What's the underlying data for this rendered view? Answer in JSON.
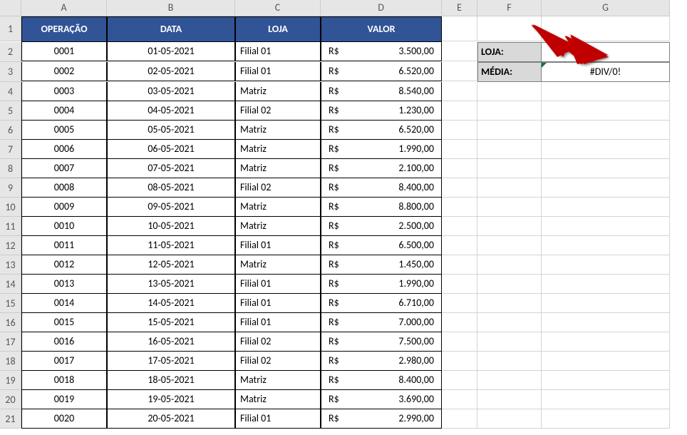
{
  "columns": [
    "A",
    "B",
    "C",
    "D",
    "E",
    "F",
    "G"
  ],
  "header": {
    "operacao": "OPERAÇÃO",
    "data": "DATA",
    "loja": "LOJA",
    "valor": "VALOR"
  },
  "rows": [
    {
      "op": "0001",
      "data": "01-05-2021",
      "loja": "Filial 01",
      "cur": "R$",
      "val": "3.500,00"
    },
    {
      "op": "0002",
      "data": "02-05-2021",
      "loja": "Filial 01",
      "cur": "R$",
      "val": "6.520,00"
    },
    {
      "op": "0003",
      "data": "03-05-2021",
      "loja": "Matriz",
      "cur": "R$",
      "val": "8.540,00"
    },
    {
      "op": "0004",
      "data": "04-05-2021",
      "loja": "Filial 02",
      "cur": "R$",
      "val": "1.230,00"
    },
    {
      "op": "0005",
      "data": "05-05-2021",
      "loja": "Matriz",
      "cur": "R$",
      "val": "6.520,00"
    },
    {
      "op": "0006",
      "data": "06-05-2021",
      "loja": "Matriz",
      "cur": "R$",
      "val": "1.990,00"
    },
    {
      "op": "0007",
      "data": "07-05-2021",
      "loja": "Matriz",
      "cur": "R$",
      "val": "2.100,00"
    },
    {
      "op": "0008",
      "data": "08-05-2021",
      "loja": "Filial 02",
      "cur": "R$",
      "val": "8.400,00"
    },
    {
      "op": "0009",
      "data": "09-05-2021",
      "loja": "Matriz",
      "cur": "R$",
      "val": "8.800,00"
    },
    {
      "op": "0010",
      "data": "10-05-2021",
      "loja": "Matriz",
      "cur": "R$",
      "val": "2.500,00"
    },
    {
      "op": "0011",
      "data": "11-05-2021",
      "loja": "Filial 01",
      "cur": "R$",
      "val": "6.500,00"
    },
    {
      "op": "0012",
      "data": "12-05-2021",
      "loja": "Matriz",
      "cur": "R$",
      "val": "1.450,00"
    },
    {
      "op": "0013",
      "data": "13-05-2021",
      "loja": "Filial 01",
      "cur": "R$",
      "val": "1.990,00"
    },
    {
      "op": "0014",
      "data": "14-05-2021",
      "loja": "Filial 01",
      "cur": "R$",
      "val": "6.710,00"
    },
    {
      "op": "0015",
      "data": "15-05-2021",
      "loja": "Filial 01",
      "cur": "R$",
      "val": "7.000,00"
    },
    {
      "op": "0016",
      "data": "16-05-2021",
      "loja": "Filial 02",
      "cur": "R$",
      "val": "7.500,00"
    },
    {
      "op": "0017",
      "data": "17-05-2021",
      "loja": "Filial 02",
      "cur": "R$",
      "val": "2.980,00"
    },
    {
      "op": "0018",
      "data": "18-05-2021",
      "loja": "Matriz",
      "cur": "R$",
      "val": "8.400,00"
    },
    {
      "op": "0019",
      "data": "19-05-2021",
      "loja": "Matriz",
      "cur": "R$",
      "val": "3.690,00"
    },
    {
      "op": "0020",
      "data": "20-05-2021",
      "loja": "Filial 01",
      "cur": "R$",
      "val": "2.990,00"
    }
  ],
  "side": {
    "loja_label": "LOJA:",
    "loja_value": "",
    "media_label": "MÉDIA:",
    "media_value": "#DIV/0!"
  }
}
